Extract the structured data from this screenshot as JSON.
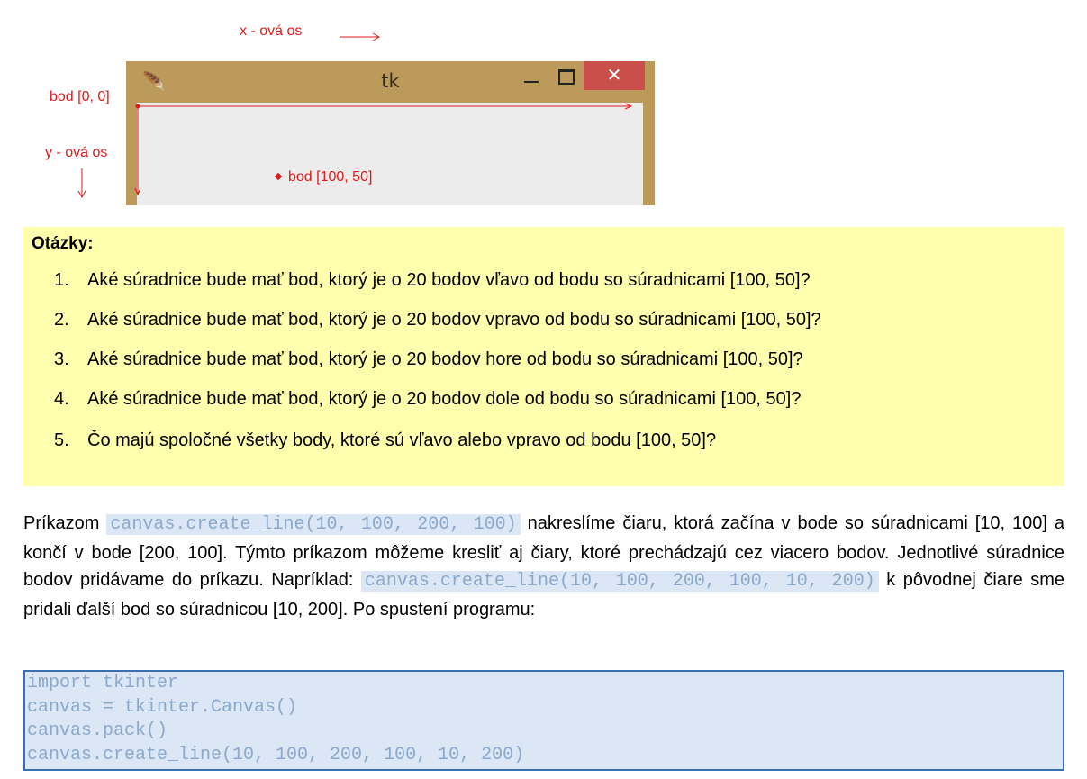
{
  "diagram": {
    "x_axis_label": "x - ová os",
    "y_axis_label": "y - ová os",
    "origin_label": "bod [0, 0]",
    "point_label": "bod [100, 50]",
    "window_title": "tk",
    "feather_icon": "feather-icon",
    "minimize_icon": "minimize-icon",
    "maximize_icon": "maximize-icon",
    "close_icon": "close-icon",
    "close_glyph": "✕",
    "label_color": "#e0191c"
  },
  "questions": {
    "title": "Otázky:",
    "items": [
      {
        "num": "1.",
        "text": "Aké súradnice bude mať bod, ktorý je o 20 bodov vľavo od bodu so súradnicami [100, 50]?"
      },
      {
        "num": "2.",
        "text": "Aké súradnice bude mať bod, ktorý je o 20 bodov vpravo od bodu so súradnicami [100, 50]?"
      },
      {
        "num": "3.",
        "text": "Aké súradnice bude mať bod, ktorý je o 20 bodov hore od bodu so súradnicami [100, 50]?"
      },
      {
        "num": "4.",
        "text": "Aké súradnice bude mať bod, ktorý je o 20 bodov dole od bodu so súradnicami [100, 50]?"
      },
      {
        "num": "5.",
        "text": "Čo majú spoločné všetky body, ktoré sú vľavo alebo vpravo od bodu [100, 50]?"
      }
    ],
    "background": "#ffffad"
  },
  "paragraph": {
    "t1": "Príkazom ",
    "code1": "canvas.create_line(10, 100, 200, 100)",
    "t2": " nakreslíme čiaru, ktorá začína v bode so súradnicami [10, 100] a končí v bode [200, 100]. Týmto príkazom môžeme kresliť aj čiary, ktoré prechádzajú cez viacero bodov. Jednotlivé súradnice bodov pridávame do príkazu. Napríklad: ",
    "code2": "canvas.create_line(10, 100, 200, 100, 10, 200)",
    "t3": " k pôvodnej čiare sme pridali ďalší bod so súradnicou [10, 200]. Po spustení programu:"
  },
  "code_block": {
    "lines": [
      "import tkinter",
      "canvas = tkinter.Canvas()",
      "canvas.pack()",
      "canvas.create_line(10, 100, 200, 100, 10, 200)"
    ]
  }
}
